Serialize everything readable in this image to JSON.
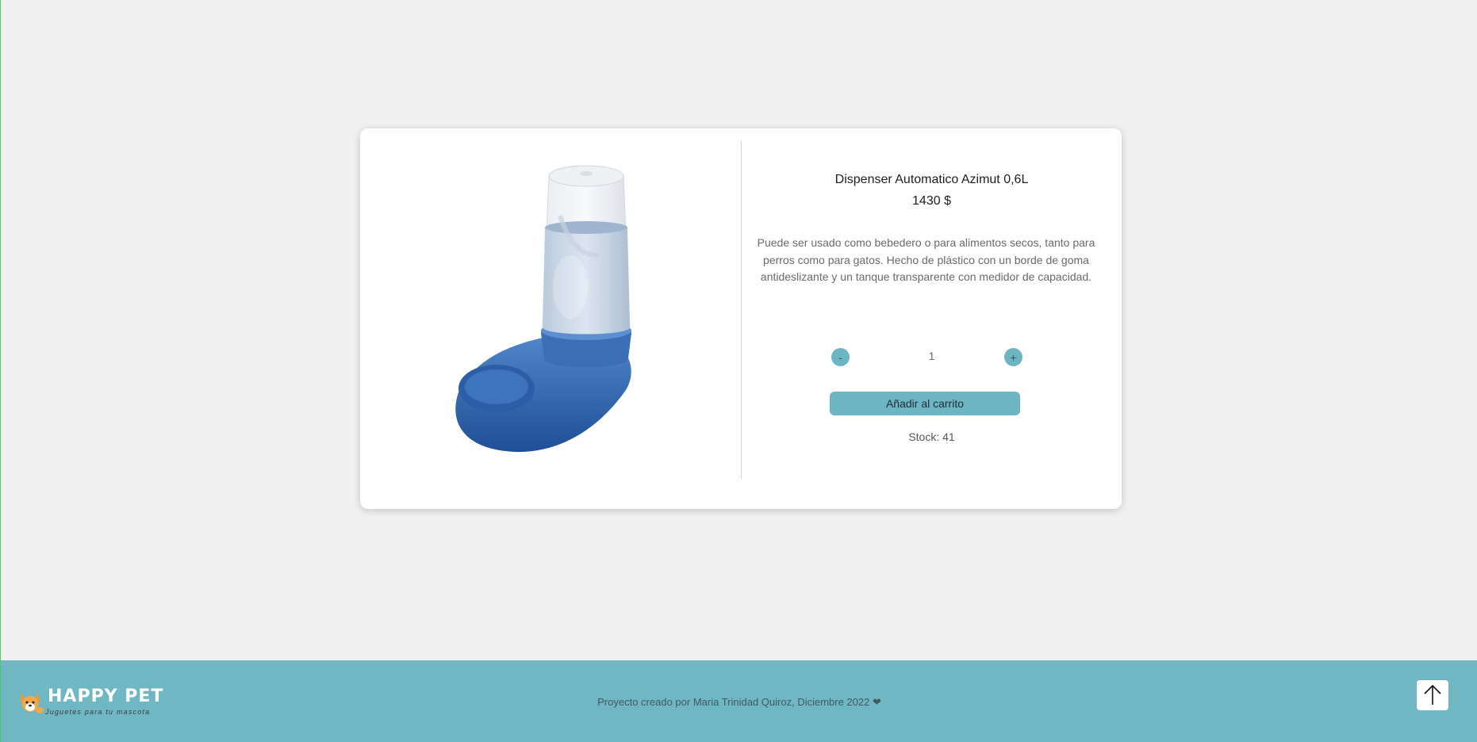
{
  "product": {
    "title": "Dispenser Automatico Azimut 0,6L",
    "price": "1430 $",
    "description": "Puede ser usado como bebedero o para alimentos secos, tanto para perros como para gatos. Hecho de plástico con un borde de goma antideslizante y un tanque transparente con medidor de capacidad.",
    "image_alt": "dispenser-image"
  },
  "cart": {
    "decrement_label": "-",
    "increment_label": "+",
    "quantity": "1",
    "add_label": "Añadir al carrito",
    "stock_text": "Stock: 41"
  },
  "footer": {
    "brand": "HAPPY PET",
    "tagline": "Juguetes para tu mascota",
    "credit": "Proyecto creado por Maria Trinidad Quiroz, Diciembre 2022 ❤"
  },
  "colors": {
    "accent": "#6cb6c3",
    "footer_bg": "#6fb7c3",
    "page_bg": "#f0f0f0",
    "product_blue": "#2f63ad"
  },
  "icons": {
    "scroll_top": "arrow-up-icon",
    "logo": "corgi-dog-icon"
  }
}
